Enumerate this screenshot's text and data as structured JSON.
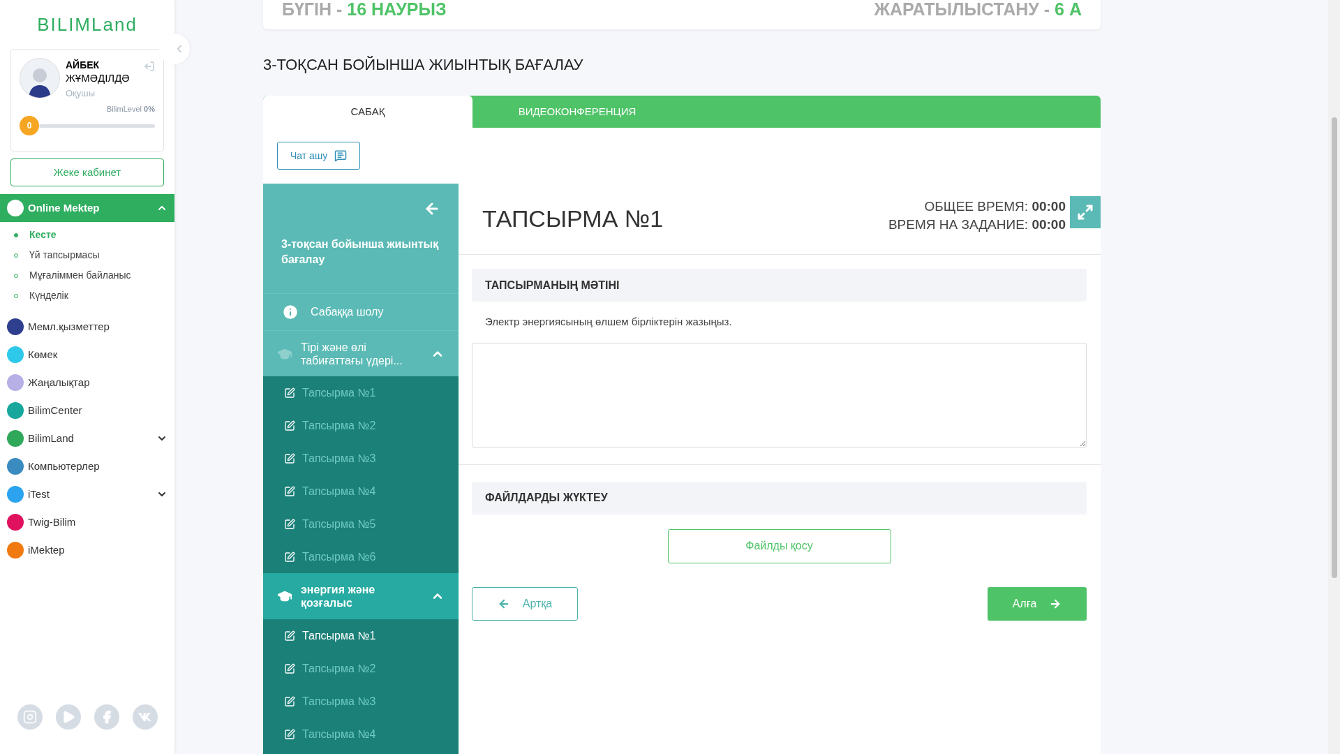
{
  "sidebar": {
    "logo": "BILIMLand",
    "profile": {
      "first_name": "АЙБЕК",
      "last_name": "ЖҰМӘДІЛДӘ",
      "role": "Оқушы",
      "level_badge": "0",
      "level_label": "BilimLevel",
      "level_percent": "0%",
      "level": 0
    },
    "cabinet_button": "Жеке кабинет",
    "items": [
      {
        "label": "Online Mektep",
        "color": "#ffffff",
        "active": true,
        "expanded": true,
        "children": [
          {
            "label": "Кесте",
            "selected": true
          },
          {
            "label": "Үй тапсырмасы",
            "selected": false
          },
          {
            "label": "Мұғаліммен байланыс",
            "selected": false
          },
          {
            "label": "Күнделік",
            "selected": false
          }
        ]
      },
      {
        "label": "Мемл.қызметтер",
        "color": "#2f3f8f",
        "active": false
      },
      {
        "label": "Көмек",
        "color": "#2ec9ea",
        "active": false
      },
      {
        "label": "Жаңалықтар",
        "color": "#b7b0e6",
        "active": false
      },
      {
        "label": "BilimCenter",
        "color": "#17a79c",
        "active": false
      },
      {
        "label": "BilimLand",
        "color": "#2fa85a",
        "active": false,
        "expanded": false
      },
      {
        "label": "Компьютерлер",
        "color": "#3a8bbf",
        "active": false
      },
      {
        "label": "iTest",
        "color": "#2ba3ef",
        "active": false,
        "expanded": false
      },
      {
        "label": "Twig-Bilim",
        "color": "#e0115f",
        "active": false
      },
      {
        "label": "iMektep",
        "color": "#f07a10",
        "active": false
      }
    ]
  },
  "header": {
    "date_label": "БҮГІН - ",
    "date": "16 НАУРЫЗ",
    "subject_label": "ЖАРАТЫЛЫСТАНУ - ",
    "class": "6 А"
  },
  "page_title": "3-ТОҚСАН БОЙЫНША ЖИЫНТЫҚ БАҒАЛАУ",
  "tabs": [
    {
      "label": "САБАҚ",
      "selected": true
    },
    {
      "label": "ВИДЕОКОНФЕРЕНЦИЯ",
      "selected": false
    }
  ],
  "chat_button": "Чат ашу",
  "lesson_nav": {
    "title": "3-тоқсан бойынша жиынтық бағалау",
    "overview": "Сабаққа шолу",
    "sections": [
      {
        "title": "Тірі және өлі табиғаттағы үдері...",
        "selected": false,
        "expanded": true,
        "tasks": [
          {
            "label": "Тапсырма №1",
            "selected": false
          },
          {
            "label": "Тапсырма №2",
            "selected": false
          },
          {
            "label": "Тапсырма №3",
            "selected": false
          },
          {
            "label": "Тапсырма №4",
            "selected": false
          },
          {
            "label": "Тапсырма №5",
            "selected": false
          },
          {
            "label": "Тапсырма №6",
            "selected": false
          }
        ]
      },
      {
        "title": "энергия және қозғалыс",
        "selected": true,
        "expanded": true,
        "tasks": [
          {
            "label": "Тапсырма №1",
            "selected": true
          },
          {
            "label": "Тапсырма №2",
            "selected": false
          },
          {
            "label": "Тапсырма №3",
            "selected": false
          },
          {
            "label": "Тапсырма №4",
            "selected": false
          }
        ]
      }
    ]
  },
  "task": {
    "title": "ТАПСЫРМА №1",
    "total_time_label": "ОБЩЕЕ ВРЕМЯ: ",
    "total_time": "00:00",
    "task_time_label": "ВРЕМЯ НА ЗАДАНИЕ: ",
    "task_time": "00:00",
    "text_heading": "ТАПСЫРМАНЫҢ МӘТІНІ",
    "text": "Электр энергиясының өлшем бірліктерін жазыңыз.",
    "files_heading": "ФАЙЛДАРДЫ ЖҮКТЕУ",
    "add_file_button": "Файлды қосу",
    "back_button": "Артқа",
    "next_button": "Алға"
  }
}
